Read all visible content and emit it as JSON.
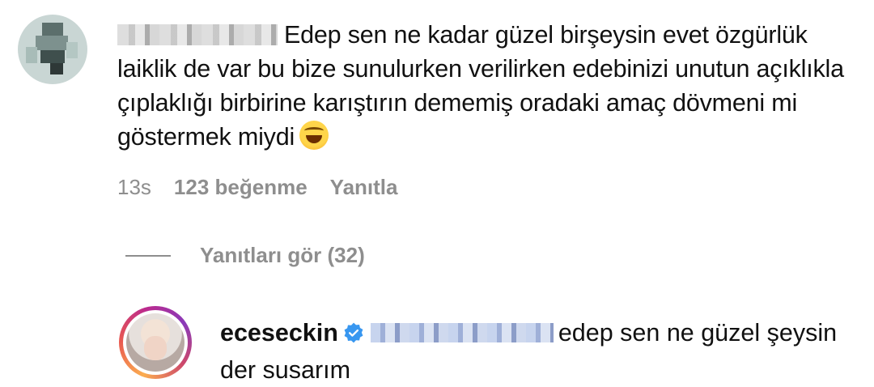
{
  "comment": {
    "username_blurred": true,
    "text": "Edep sen ne kadar güzel birşeysin evet özgürlük laiklik de var bu bize sunulurken verilirken edebinizi unutun açıklıkla çıplaklığı birbirine karıştırın dememiş oradaki amaç dövmeni mi göstermek miydi",
    "emoji": "face-with-tears-of-joy",
    "time": "13s",
    "likes": "123 beğenme",
    "reply_action": "Yanıtla"
  },
  "replies_toggle": {
    "label": "Yanıtları gör (32)"
  },
  "reply": {
    "username": "eceseckin",
    "verified_icon": "verified-badge-icon",
    "mention_blurred": true,
    "text": "edep sen ne güzel şeysin der susarım",
    "colors": {
      "verified": "#3897f0",
      "story_ring": [
        "#fbad50",
        "#e95950",
        "#bc2a8d",
        "#8a3ab9"
      ]
    }
  }
}
